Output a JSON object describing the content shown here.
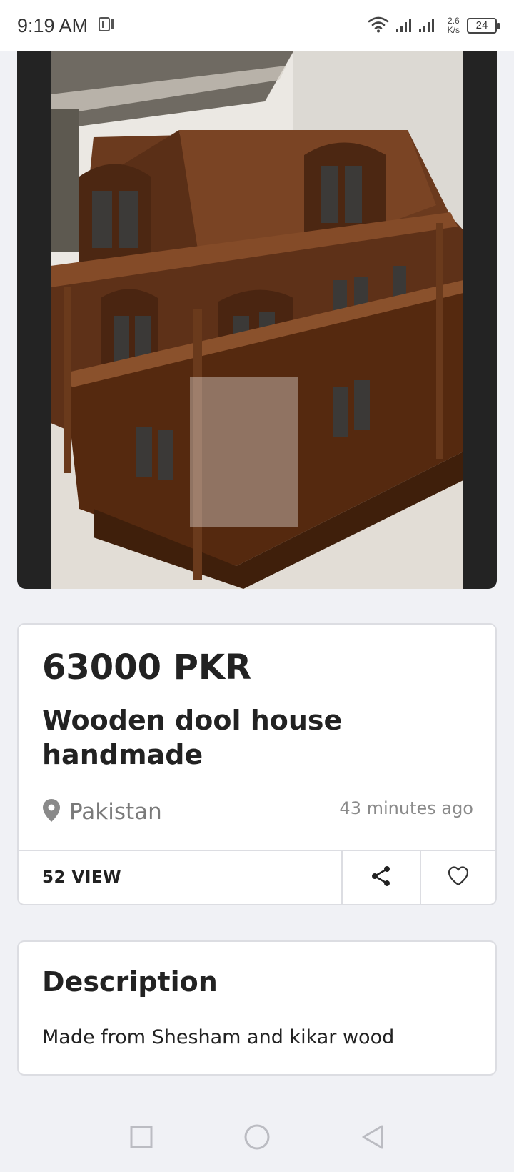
{
  "status_bar": {
    "time": "9:19 AM",
    "net_speed_value": "2.6",
    "net_speed_unit": "K/s",
    "battery": "24"
  },
  "listing": {
    "price": "63000 PKR",
    "title": "Wooden dool house handmade",
    "location": "Pakistan",
    "posted": "43 minutes ago",
    "views": "52 VIEW"
  },
  "description": {
    "heading": "Description",
    "text": "Made from Shesham and kikar wood"
  },
  "colors": {
    "background": "#f0f1f5",
    "card": "#ffffff",
    "text": "#222222",
    "muted": "#7a7a7a"
  },
  "icons": {
    "status": [
      "sim-icon",
      "wifi-icon",
      "signal-icon",
      "battery-icon"
    ],
    "card": [
      "location-pin-icon",
      "share-icon",
      "heart-icon"
    ],
    "nav": [
      "recent-apps-icon",
      "home-icon",
      "back-icon"
    ]
  }
}
